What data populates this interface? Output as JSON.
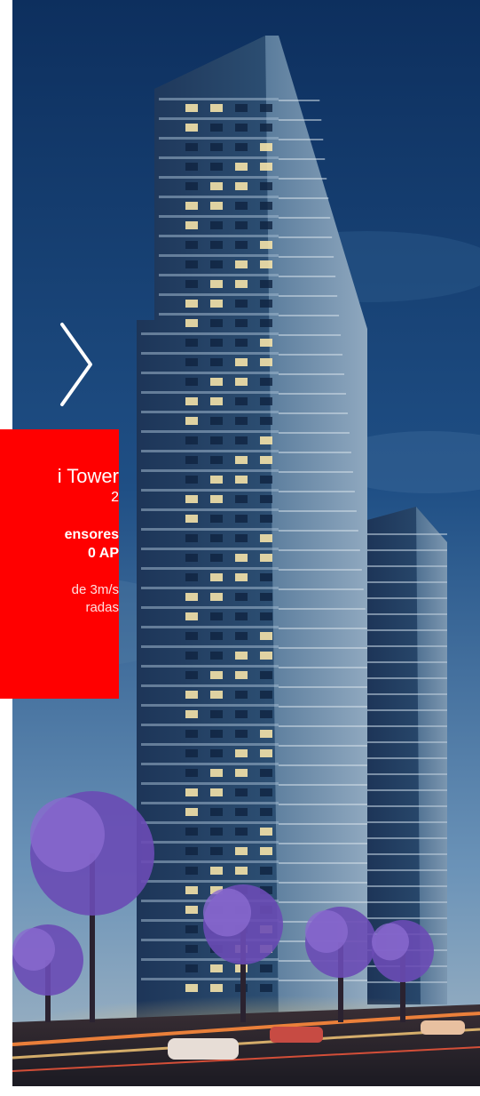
{
  "slide": {
    "title": "i Tower",
    "subtitle": "2",
    "spec_line1": "ensores",
    "spec_line2": "0 AP",
    "detail_line1": "de 3m/s",
    "detail_line2": "radas"
  },
  "colors": {
    "card_bg": "#ff0000",
    "card_text": "#ffffff",
    "sky_top": "#0d2f5e",
    "sky_bottom": "#6b93b8"
  },
  "icons": {
    "next": "chevron-right-icon"
  }
}
